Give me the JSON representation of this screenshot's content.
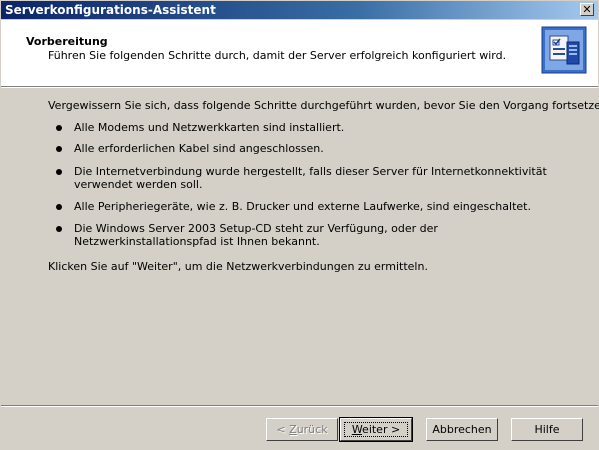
{
  "window": {
    "title": "Serverkonfigurations-Assistent",
    "close_glyph": "✕"
  },
  "header": {
    "title": "Vorbereitung",
    "subtitle": "Führen Sie folgenden Schritte durch, damit der Server erfolgreich konfiguriert wird.",
    "icon": "wizard-checklist-icon"
  },
  "content": {
    "intro": "Vergewissern Sie sich, dass folgende Schritte durchgeführt wurden, bevor Sie den Vorgang fortsetzen.",
    "steps": [
      "Alle Modems und Netzwerkkarten sind installiert.",
      "Alle erforderlichen Kabel sind angeschlossen.",
      "Die Internetverbindung wurde hergestellt, falls dieser Server für Internetkonnektivität verwendet werden soll.",
      "Alle Peripheriegeräte, wie z. B. Drucker und externe Laufwerke, sind eingeschaltet.",
      "Die Windows Server 2003 Setup-CD steht zur Verfügung, oder der Netzwerkinstallationspfad ist Ihnen bekannt."
    ],
    "footer": "Klicken Sie auf \"Weiter\", um die Netzwerkverbindungen zu ermitteln."
  },
  "buttons": {
    "back_prefix": "< ",
    "back_accel": "Z",
    "back_rest": "urück",
    "next_accel": "W",
    "next_rest": "eiter >",
    "cancel": "Abbrechen",
    "help": "Hilfe"
  },
  "colors": {
    "titlebar_start": "#0a246a",
    "titlebar_end": "#a6caf0",
    "face": "#d4d0c8"
  }
}
